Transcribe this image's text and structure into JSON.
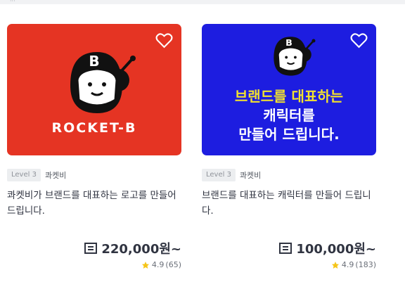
{
  "top_fragment": "···",
  "cards": [
    {
      "thumb_bg": "#e53423",
      "thumb_text": "ROCKET-B",
      "level": "Level 3",
      "seller": "콰켓비",
      "title": "콰켓비가 브랜드를 대표하는 로고를 만들어 드립니다.",
      "price": "220,000원~",
      "rating": "4.9",
      "reviews": "(65)"
    },
    {
      "thumb_bg": "#1d1de0",
      "banner_line1": "브랜드를 대표하는",
      "banner_line2": "캐릭터를",
      "banner_line3": "만들어 드립니다.",
      "level": "Level 3",
      "seller": "콰켓비",
      "title": "브랜드를 대표하는 캐릭터를 만들어 드립니다.",
      "price": "100,000원~",
      "rating": "4.9",
      "reviews": "(183)"
    }
  ],
  "colors": {
    "star": "#f5c518",
    "text": "#303441",
    "banner_yellow": "#f2e22e"
  },
  "icons": {
    "favorite": "heart-outline-icon",
    "price": "receipt-icon",
    "rating": "star-icon",
    "mascot_letter": "B"
  }
}
